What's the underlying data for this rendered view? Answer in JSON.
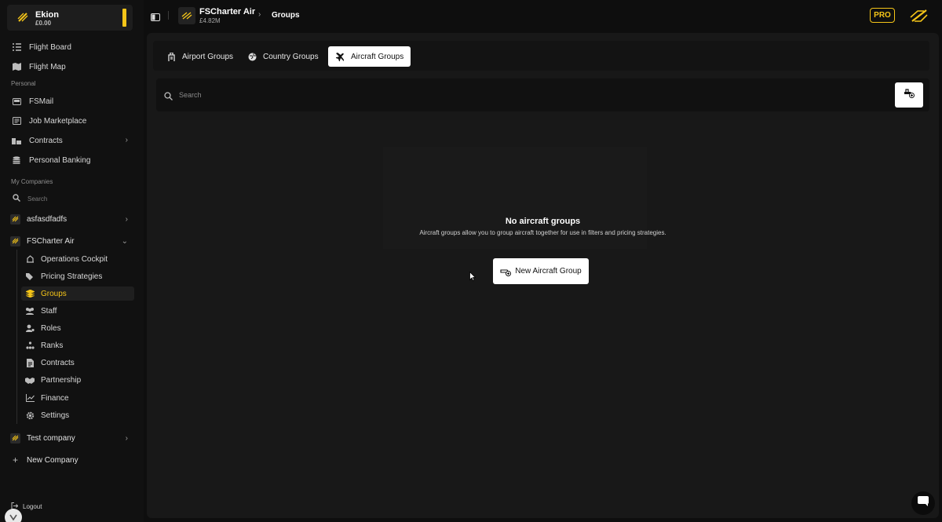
{
  "user": {
    "name": "Ekion",
    "balance": "£0.00"
  },
  "nav": {
    "flight_board": "Flight Board",
    "flight_map": "Flight Map",
    "personal_label": "Personal",
    "fsmail": "FSMail",
    "job_marketplace": "Job Marketplace",
    "contracts": "Contracts",
    "personal_banking": "Personal Banking",
    "my_companies_label": "My Companies",
    "search_placeholder": "Search"
  },
  "companies": [
    {
      "name": "asfasdfadfs"
    },
    {
      "name": "FSCharter Air"
    },
    {
      "name": "Test company"
    }
  ],
  "company_menu": [
    {
      "label": "Operations Cockpit",
      "icon": "cockpit-icon"
    },
    {
      "label": "Pricing Strategies",
      "icon": "tags-icon"
    },
    {
      "label": "Groups",
      "icon": "layers-icon"
    },
    {
      "label": "Staff",
      "icon": "users-icon"
    },
    {
      "label": "Roles",
      "icon": "user-gear-icon"
    },
    {
      "label": "Ranks",
      "icon": "ranks-icon"
    },
    {
      "label": "Contracts",
      "icon": "file-icon"
    },
    {
      "label": "Partnership",
      "icon": "handshake-icon"
    },
    {
      "label": "Finance",
      "icon": "chart-line-icon"
    },
    {
      "label": "Settings",
      "icon": "gear-icon"
    }
  ],
  "new_company": "New Company",
  "logout": "Logout",
  "topbar": {
    "company_name": "FSCharter Air",
    "company_balance": "£4.82M",
    "breadcrumb": "Groups",
    "pro_badge": "PRO"
  },
  "tabs": [
    {
      "label": "Airport Groups",
      "icon": "airport-icon"
    },
    {
      "label": "Country Groups",
      "icon": "globe-icon"
    },
    {
      "label": "Aircraft Groups",
      "icon": "plane-icon",
      "active": true
    }
  ],
  "search": {
    "placeholder": "Search"
  },
  "empty_state": {
    "title": "No aircraft groups",
    "description": "Aircraft groups allow you to group aircraft together for use in filters and pricing strategies.",
    "button": "New Aircraft Group"
  },
  "colors": {
    "accent": "#f5c518",
    "background": "#0e0e0e",
    "panel": "#181818"
  }
}
